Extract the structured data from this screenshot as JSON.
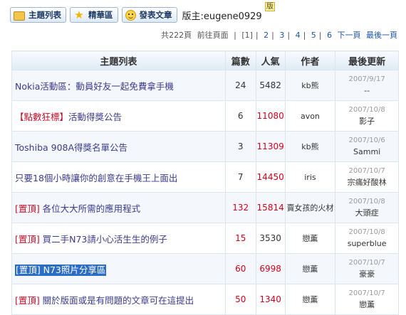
{
  "toolbar": {
    "topic_list_label": "主題列表",
    "featured_label": "精華區",
    "post_label": "發表文章",
    "moderator_text": "版主:eugene0929",
    "moderator_badge": "版"
  },
  "pager": {
    "total": "共222頁",
    "prev": "前往頁面",
    "pages": [
      "[1]",
      "2",
      "3",
      "4",
      "5",
      "6"
    ],
    "next": "下一頁",
    "last": "最後一頁"
  },
  "table": {
    "headers": [
      "主題列表",
      "篇數",
      "人氣",
      "作者",
      "最後更新"
    ],
    "rows": [
      {
        "tag": "",
        "title": "Nokia活動區：動員好友一起免費拿手機",
        "count": "24",
        "views": "5482",
        "author": "kb熊",
        "date": "2007/9/17",
        "last_user": "--"
      },
      {
        "tag": "【點數狂標】",
        "title": "活動得獎公告",
        "count": "6",
        "views": "11080",
        "author": "avon",
        "date": "2007/10/8",
        "last_user": "影子"
      },
      {
        "tag": "",
        "title": "Toshiba 908A得獎名單公告",
        "count": "3",
        "views": "11309",
        "author": "kb熊",
        "date": "2007/10/6",
        "last_user": "Sammi"
      },
      {
        "tag": "",
        "title": "只要18個小時讓你的創意在手機王上面出",
        "count": "7",
        "views": "14450",
        "author": "iris",
        "date": "2007/10/7",
        "last_user": "宗痛好酸林"
      },
      {
        "tag": "[置頂]",
        "title": "各位大大所需的應用程式",
        "count": "132",
        "views": "15814",
        "author": "賣女孩的火材",
        "date": "2007/10/8",
        "last_user": "大頭症"
      },
      {
        "tag": "[置頂]",
        "title": "買二手N73請小心活生生的例子",
        "count": "15",
        "views": "3530",
        "author": "戀薰",
        "date": "2007/10/8",
        "last_user": "superblue"
      },
      {
        "tag": "[置頂]",
        "title": "N73照片分享區",
        "count": "60",
        "views": "6998",
        "author": "戀薰",
        "date": "2007/10/7",
        "last_user": "豪豪"
      },
      {
        "tag": "[置頂]",
        "title": "關於版面或是有問題的文章可在這提出",
        "count": "50",
        "views": "1340",
        "author": "戀薰",
        "date": "2007/10/7",
        "last_user": "戀薰"
      }
    ]
  }
}
